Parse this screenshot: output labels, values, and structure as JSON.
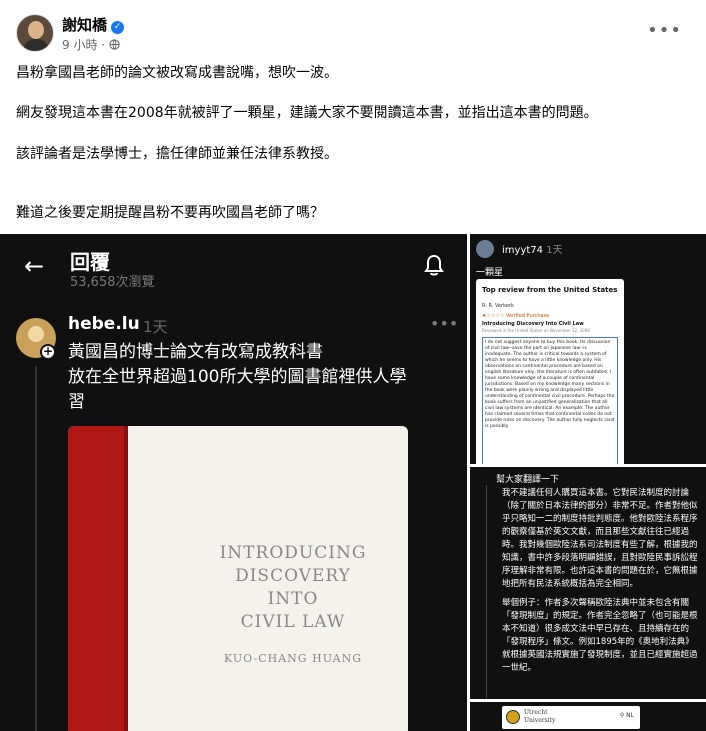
{
  "post": {
    "author": "謝知橋",
    "meta": "9 小時 · ",
    "paragraphs": [
      "昌粉拿國昌老師的論文被改寫成書說嘴，想吹一波。",
      "網友發現這本書在2008年就被評了一顆星，建議大家不要閱讀這本書，並指出這本書的問題。",
      "該評論者是法學博士，擔任律師並兼任法律系教授。",
      "難道之後要定期提醒昌粉不要再吹國昌老師了嗎？"
    ]
  },
  "threads": {
    "title": "回覆",
    "views": "53,658次瀏覽",
    "username": "hebe.lu",
    "time": "1天",
    "body_lines": [
      "黃國昌的博士論文有改寫成教科書",
      "放在全世界超過100所大學的圖書館裡供人學",
      "習"
    ],
    "book_title_lines": [
      "INTRODUCING",
      "DISCOVERY",
      "INTO",
      "CIVIL LAW"
    ],
    "book_author": "KUO-CHANG HUANG"
  },
  "review_post": {
    "username": "imyyt74",
    "time": "1天",
    "caption": "一顆星",
    "card_header": "Top review from the United States",
    "reviewer": "R. R. Verkerk",
    "stars": "★☆☆☆☆ Verified Purchase",
    "review_title": "Introducing Discovery Into Civil Law",
    "review_sub": "Reviewed in the United States on November 12, 2008",
    "review_text": "I do not suggest anyone to buy this book. Its discussion of civil law--save the part on Japanese law--is inadequate. The author is critical towards a system of which he seems to have a little knowledge only. His observations on continental procedure are based on english literature only, the literature is often outdated. I have some knowledge of a couple of continental jurisdictions. Based on my knowledge many sections in the book were plainly wrong and displayed little understanding of continental civil procedure. Perhaps the book suffers from an unjustified generalization that all civil law systems are identical. An example: The author has claimed several times that continental codes do not provide rules on discovery. The author fully neglects (and is possibly"
  },
  "translation": {
    "header": "幫大家翻譯一下",
    "paragraphs": [
      "我不建議任何人購買這本書。它對民法制度的討論（除了關於日本法律的部分）非常不足。作者對他似乎只略知一二的制度持批判態度。他對歐陸法系程序的觀察僅基於英文文獻，而且那些文獻往往已經過時。我對幾個歐陸法系司法制度有些了解，根據我的知識，書中許多段落明顯錯誤，且對歐陸民事訴訟程序理解非常有限。也許這本書的問題在於，它無根據地把所有民法系統概括為完全相同。",
      "舉個例子：作者多次聲稱歐陸法典中並未包含有關「發現制度」的規定。作者完全忽略了（也可能是根本不知道）很多成文法中早已存在、且持續存在的「發現程序」條文。例如1895年的《奧地利法典》就根據英國法規實施了發現制度，並且已經實施超過一世紀。"
    ]
  },
  "university": {
    "name_line1": "Utrecht",
    "name_line2": "University",
    "right": "NL"
  },
  "icons": {
    "more": "more-icon",
    "globe": "globe-icon",
    "verified": "verified-icon",
    "back": "back-arrow-icon",
    "bell": "bell-icon",
    "search": "search-icon"
  }
}
